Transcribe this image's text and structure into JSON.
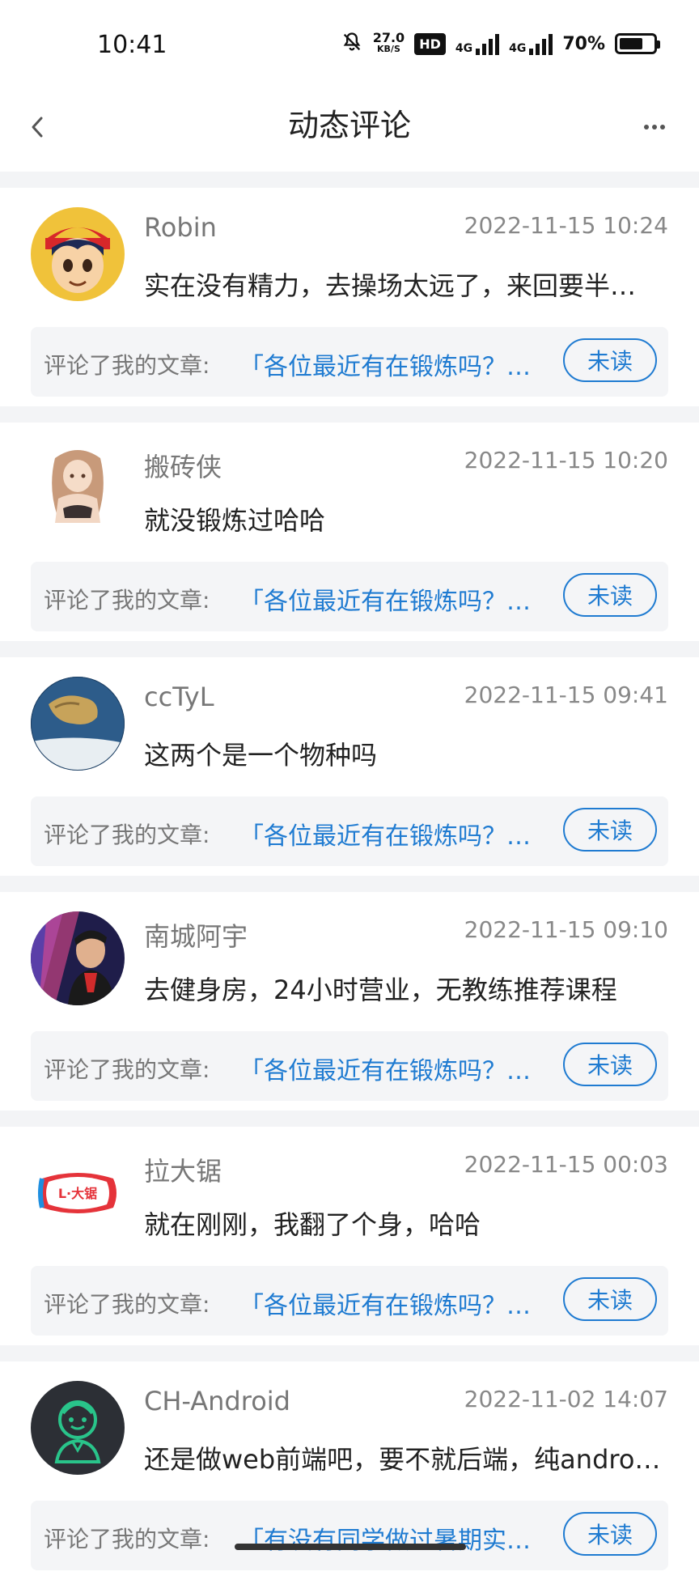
{
  "status_bar": {
    "time": "10:41",
    "speed_value": "27.0",
    "speed_unit": "KB/S",
    "hd_badge": "HD",
    "signal1_label": "4G",
    "signal2_label": "4G",
    "battery_pct": "70%",
    "battery_level": 0.7,
    "icons": [
      "bell-off-icon",
      "signal-icon",
      "battery-icon"
    ]
  },
  "nav": {
    "title": "动态评论",
    "back_icon": "chevron-left-icon",
    "more_icon": "more-horizontal-icon"
  },
  "comments": [
    {
      "username": "Robin",
      "time": "2022-11-15 10:24",
      "comment": "实在没有精力，去操场太远了，来回要半…",
      "ref_label": "评论了我的文章:",
      "article": "「各位最近有在锻炼吗？…",
      "status": "未读"
    },
    {
      "username": "搬砖侠",
      "time": "2022-11-15 10:20",
      "comment": "就没锻炼过哈哈",
      "ref_label": "评论了我的文章:",
      "article": "「各位最近有在锻炼吗？…",
      "status": "未读"
    },
    {
      "username": "ccTyL",
      "time": "2022-11-15 09:41",
      "comment": "这两个是一个物种吗",
      "ref_label": "评论了我的文章:",
      "article": "「各位最近有在锻炼吗？…",
      "status": "未读"
    },
    {
      "username": "南城阿宇",
      "time": "2022-11-15 09:10",
      "comment": "去健身房，24小时营业，无教练推荐课程",
      "ref_label": "评论了我的文章:",
      "article": "「各位最近有在锻炼吗？…",
      "status": "未读"
    },
    {
      "username": "拉大锯",
      "time": "2022-11-15 00:03",
      "comment": "就在刚刚，我翻了个身，哈哈",
      "ref_label": "评论了我的文章:",
      "article": "「各位最近有在锻炼吗？…",
      "status": "未读"
    },
    {
      "username": "CH-Android",
      "time": "2022-11-02 14:07",
      "comment": "还是做web前端吧，要不就后端，纯andro…",
      "ref_label": "评论了我的文章:",
      "article": "「有没有同学做过暑期实…",
      "status": "未读"
    }
  ],
  "avatars": {
    "robin": "avatar-cartoon-boy",
    "banzhuanxia": "avatar-anime-girl",
    "cctyl": "avatar-globe",
    "nanchengayu": "avatar-man-neon",
    "ladaju_logo_text": "L·大锯",
    "chandroid": "avatar-robot-person"
  }
}
